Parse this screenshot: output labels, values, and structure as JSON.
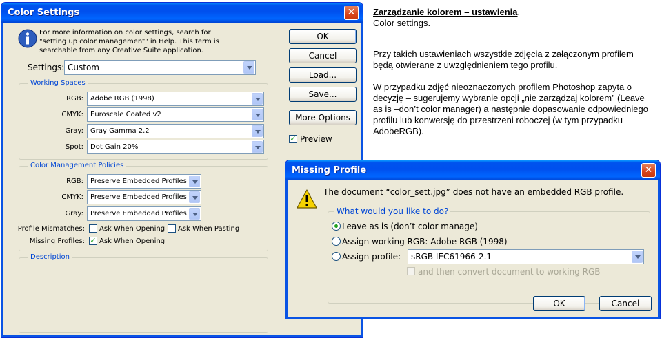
{
  "article": {
    "heading": "Zarządzanie kolorem – ustawienia",
    "heading_period": ".",
    "subheading": "Color settings.",
    "paragraph1": "Przy takich ustawieniach wszystkie zdjęcia z załączonym profilem będą otwierane z uwzględnieniem tego profilu.",
    "paragraph2": "W przypadku zdjęć nieoznaczonych profilem Photoshop zapyta o decyzję – sugerujemy wybranie opcji „nie zarządzaj kolorem” (Leave as is –don’t color manager) a następnie dopasowanie odpowiedniego profilu lub konwersję do przestrzeni roboczej (w tym przypadku AdobeRGB)."
  },
  "color_settings": {
    "title": "Color Settings",
    "close": "✕",
    "info_text": "For more information on color settings, search for \"setting up color management\" in Help. This term is searchable from any Creative Suite application.",
    "settings_label": "Settings:",
    "settings_value": "Custom",
    "buttons": {
      "ok": "OK",
      "cancel": "Cancel",
      "load": "Load...",
      "save": "Save...",
      "more_options": "More Options"
    },
    "preview_label": "Preview",
    "preview_checked": true,
    "working_spaces": {
      "title": "Working Spaces",
      "rgb_label": "RGB:",
      "rgb_value": "Adobe RGB (1998)",
      "cmyk_label": "CMYK:",
      "cmyk_value": "Euroscale Coated v2",
      "gray_label": "Gray:",
      "gray_value": "Gray Gamma 2.2",
      "spot_label": "Spot:",
      "spot_value": "Dot Gain 20%"
    },
    "policies": {
      "title": "Color Management Policies",
      "rgb_label": "RGB:",
      "rgb_value": "Preserve Embedded Profiles",
      "cmyk_label": "CMYK:",
      "cmyk_value": "Preserve Embedded Profiles",
      "gray_label": "Gray:",
      "gray_value": "Preserve Embedded Profiles",
      "mismatch_label": "Profile Mismatches:",
      "ask_opening": "Ask When Opening",
      "ask_pasting": "Ask When Pasting",
      "missing_label": "Missing Profiles:",
      "missing_ask_opening": "Ask When Opening"
    },
    "description": {
      "title": "Description"
    }
  },
  "missing_profile": {
    "title": "Missing Profile",
    "close": "✕",
    "message": "The document “color_sett.jpg” does not have an embedded RGB profile.",
    "question": "What would you like to do?",
    "option_leave": "Leave as is (don’t color manage)",
    "option_working": "Assign working RGB:  Adobe RGB (1998)",
    "option_profile": "Assign profile:",
    "profile_value": "sRGB IEC61966-2.1",
    "convert_label": "and then convert document to working RGB",
    "selected_option": "leave",
    "ok": "OK",
    "cancel": "Cancel"
  }
}
